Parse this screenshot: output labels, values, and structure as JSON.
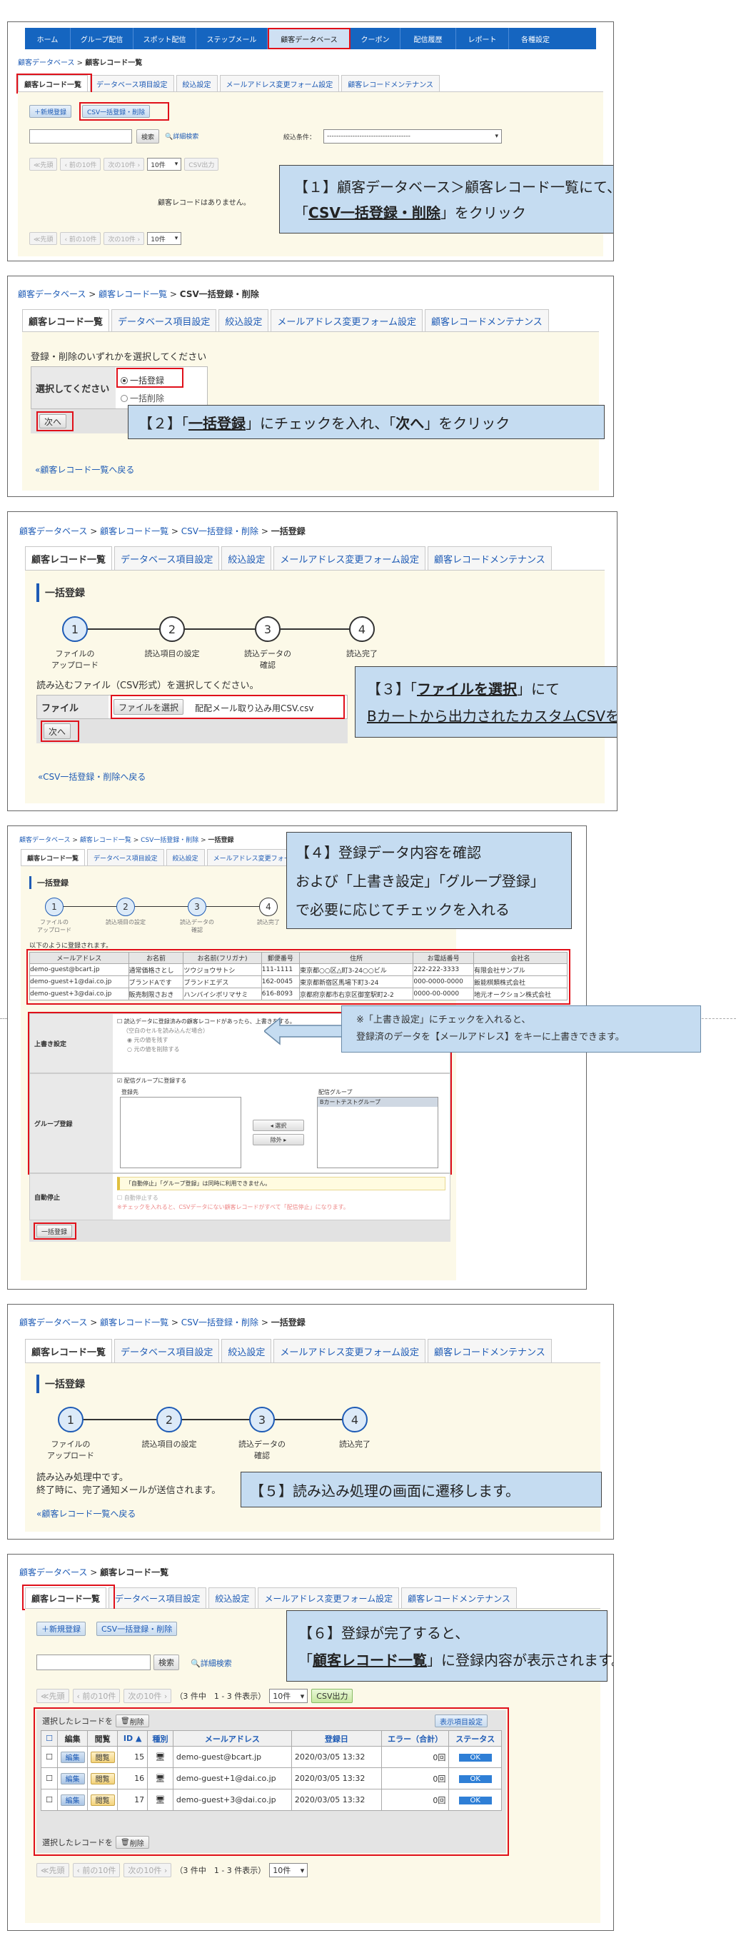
{
  "nav": [
    "ホーム",
    "グループ配信",
    "スポット配信",
    "ステップメール",
    "顧客データベース",
    "クーポン",
    "配信履歴",
    "レポート",
    "各種設定"
  ],
  "tabs": [
    "顧客レコード一覧",
    "データベース項目設定",
    "絞込設定",
    "メールアドレス変更フォーム設定",
    "顧客レコードメンテナンス"
  ],
  "p1": {
    "bc1": "顧客データベース",
    "bc2": "顧客レコード一覧",
    "btn_new": "＋新規登録",
    "btn_csv": "CSV一括登録・削除",
    "btn_search": "検索",
    "adv_search": "詳細検索",
    "filter_label": "絞込条件：",
    "filter_value": "------------------------------------",
    "pg_first": "≪先頭",
    "pg_prev": "‹ 前の10件",
    "pg_next": "次の10件 ›",
    "per_page": "10件",
    "csv_out": "CSV出力",
    "empty": "顧客レコードはありません。",
    "callout_a": "【１】顧客データベース＞顧客レコード一覧にて、",
    "callout_b1": "「",
    "callout_b2": "CSV一括登録・削除",
    "callout_b3": "」をクリック"
  },
  "p2": {
    "bc1": "顧客データベース",
    "bc2": "顧客レコード一覧",
    "bc3": "CSV一括登録・削除",
    "prompt": "登録・削除のいずれかを選択してください",
    "row_label": "選択してください",
    "opt1": "一括登録",
    "opt2": "一括削除",
    "next": "次へ",
    "back": "顧客レコード一覧へ戻る",
    "callout_a": "【２】「",
    "callout_b": "一括登録",
    "callout_c": "」にチェックを入れ、「",
    "callout_d": "次へ",
    "callout_e": "」をクリック"
  },
  "p3": {
    "bc1": "顧客データベース",
    "bc2": "顧客レコード一覧",
    "bc3": "CSV一括登録・削除",
    "bc4": "一括登録",
    "title": "一括登録",
    "steps": [
      {
        "n": "1",
        "l1": "ファイルの",
        "l2": "アップロード"
      },
      {
        "n": "2",
        "l1": "読込項目の設定",
        "l2": ""
      },
      {
        "n": "3",
        "l1": "読込データの",
        "l2": "確認"
      },
      {
        "n": "4",
        "l1": "読込完了",
        "l2": ""
      }
    ],
    "prompt": "読み込むファイル（CSV形式）を選択してください。",
    "file_label": "ファイル",
    "file_btn": "ファイルを選択",
    "file_name": "配配メール取り込み用CSV.csv",
    "next": "次へ",
    "back": "CSV一括登録・削除へ戻る",
    "callout_a1": "【３】「",
    "callout_a2": "ファイルを選択",
    "callout_a3": "」にて",
    "callout_b": "Bカートから出力されたカスタムCSVを選択"
  },
  "p4": {
    "bc1": "顧客データベース",
    "bc2": "顧客レコード一覧",
    "bc3": "CSV一括登録・削除",
    "bc4": "一括登録",
    "title": "一括登録",
    "steps": [
      {
        "n": "1",
        "l1": "ファイルの",
        "l2": "アップロード"
      },
      {
        "n": "2",
        "l1": "読込項目の設定",
        "l2": ""
      },
      {
        "n": "3",
        "l1": "読込データの",
        "l2": "確認"
      },
      {
        "n": "4",
        "l1": "読込完了",
        "l2": ""
      }
    ],
    "intro": "以下のように登録されます。",
    "headers": [
      "メールアドレス",
      "お名前",
      "お名前(フリガナ)",
      "郵便番号",
      "住所",
      "お電話番号",
      "会社名"
    ],
    "rows": [
      [
        "demo-guest@bcart.jp",
        "通常価格さとし",
        "ツウジョウサトシ",
        "111-1111",
        "東京都○○区△町3-24○○ビル",
        "222-222-3333",
        "有限会社サンプル"
      ],
      [
        "demo-guest+1@dai.co.jp",
        "ブランドAです",
        "ブランドエデス",
        "162-0045",
        "東京都新宿区馬場下町3-24",
        "000-0000-0000",
        "飯能棋類株式会社"
      ],
      [
        "demo-guest+3@dai.co.jp",
        "販売制限さおき",
        "ハンバイシボリマサミ",
        "616-8093",
        "京都府京都市右京区御室駅町2-2",
        "0000-00-0000",
        "地元オークション株式会社"
      ]
    ],
    "ow_label": "上書き設定",
    "ow_check": "読込データに登録済みの顧客レコードがあったら、上書きをする。",
    "ow_note": "（空白のセルを読み込んだ場合）",
    "ow_r1": "元の値を残す",
    "ow_r2": "元の値を削除する",
    "grp_label": "グループ登録",
    "grp_check": "配信グループに登録する",
    "grp_src": "登録先",
    "grp_dst": "配信グループ",
    "grp_item": "Bカートテストグループ",
    "grp_select": "◂ 選択",
    "grp_remove": "除外 ▸",
    "stop_label": "自動停止",
    "stop_note": "「自動停止」「グループ登録」は同時に利用できません。",
    "stop_check": "自動停止する",
    "stop_warn": "※チェックを入れると、CSVデータにない顧客レコードがすべて「配信停止」になります。",
    "submit": "一括登録",
    "callout_a": "【４】登録データ内容を確認",
    "callout_b": "および「上書き設定」「グループ登録」",
    "callout_c": "で必要に応じてチェックを入れる",
    "note_a": "※「上書き設定」にチェックを入れると、",
    "note_b": "登録済のデータを【メールアドレス】をキーに上書きできます。"
  },
  "p5": {
    "bc1": "顧客データベース",
    "bc2": "顧客レコード一覧",
    "bc3": "CSV一括登録・削除",
    "bc4": "一括登録",
    "title": "一括登録",
    "steps": [
      {
        "n": "1",
        "l1": "ファイルの",
        "l2": "アップロード"
      },
      {
        "n": "2",
        "l1": "読込項目の設定",
        "l2": ""
      },
      {
        "n": "3",
        "l1": "読込データの",
        "l2": "確認"
      },
      {
        "n": "4",
        "l1": "読込完了",
        "l2": ""
      }
    ],
    "msg1": "読み込み処理中です。",
    "msg2": "終了時に、完了通知メールが送信されます。",
    "back": "顧客レコード一覧へ戻る",
    "callout": "【５】読み込み処理の画面に遷移します。"
  },
  "p6": {
    "bc1": "顧客データベース",
    "bc2": "顧客レコード一覧",
    "btn_new": "＋新規登録",
    "btn_csv": "CSV一括登録・削除",
    "btn_search": "検索",
    "adv_search": "詳細検索",
    "pg_first": "≪先頭",
    "pg_prev": "‹ 前の10件",
    "pg_next": "次の10件 ›",
    "count": "（3 件中　1 - 3 件表示）",
    "per_page": "10件",
    "csv_out": "CSV出力",
    "sel_label": "選択したレコードを",
    "del": "削除",
    "col_btn": "表示項目設定",
    "headers": [
      "編集",
      "閲覧",
      "ID ▲",
      "種別",
      "メールアドレス",
      "登録日",
      "エラー（合計）",
      "ステータス"
    ],
    "rows": [
      {
        "edit": "編集",
        "view": "閲覧",
        "id": "15",
        "email": "demo-guest@bcart.jp",
        "date": "2020/03/05 13:32",
        "err": "0回",
        "status": "OK"
      },
      {
        "edit": "編集",
        "view": "閲覧",
        "id": "16",
        "email": "demo-guest+1@dai.co.jp",
        "date": "2020/03/05 13:32",
        "err": "0回",
        "status": "OK"
      },
      {
        "edit": "編集",
        "view": "閲覧",
        "id": "17",
        "email": "demo-guest+3@dai.co.jp",
        "date": "2020/03/05 13:32",
        "err": "0回",
        "status": "OK"
      }
    ],
    "callout_a": "【６】登録が完了すると、",
    "callout_b1": "「",
    "callout_b2": "顧客レコード一覧",
    "callout_b3": "」に登録内容が表示されます。"
  },
  "colors": {
    "nav": "#1565c0",
    "link": "#1e5bb5",
    "callout": "#c5dcf1",
    "highlight": "#e0101a",
    "body": "#fcf9e8",
    "ok": "#2f7fd6"
  }
}
